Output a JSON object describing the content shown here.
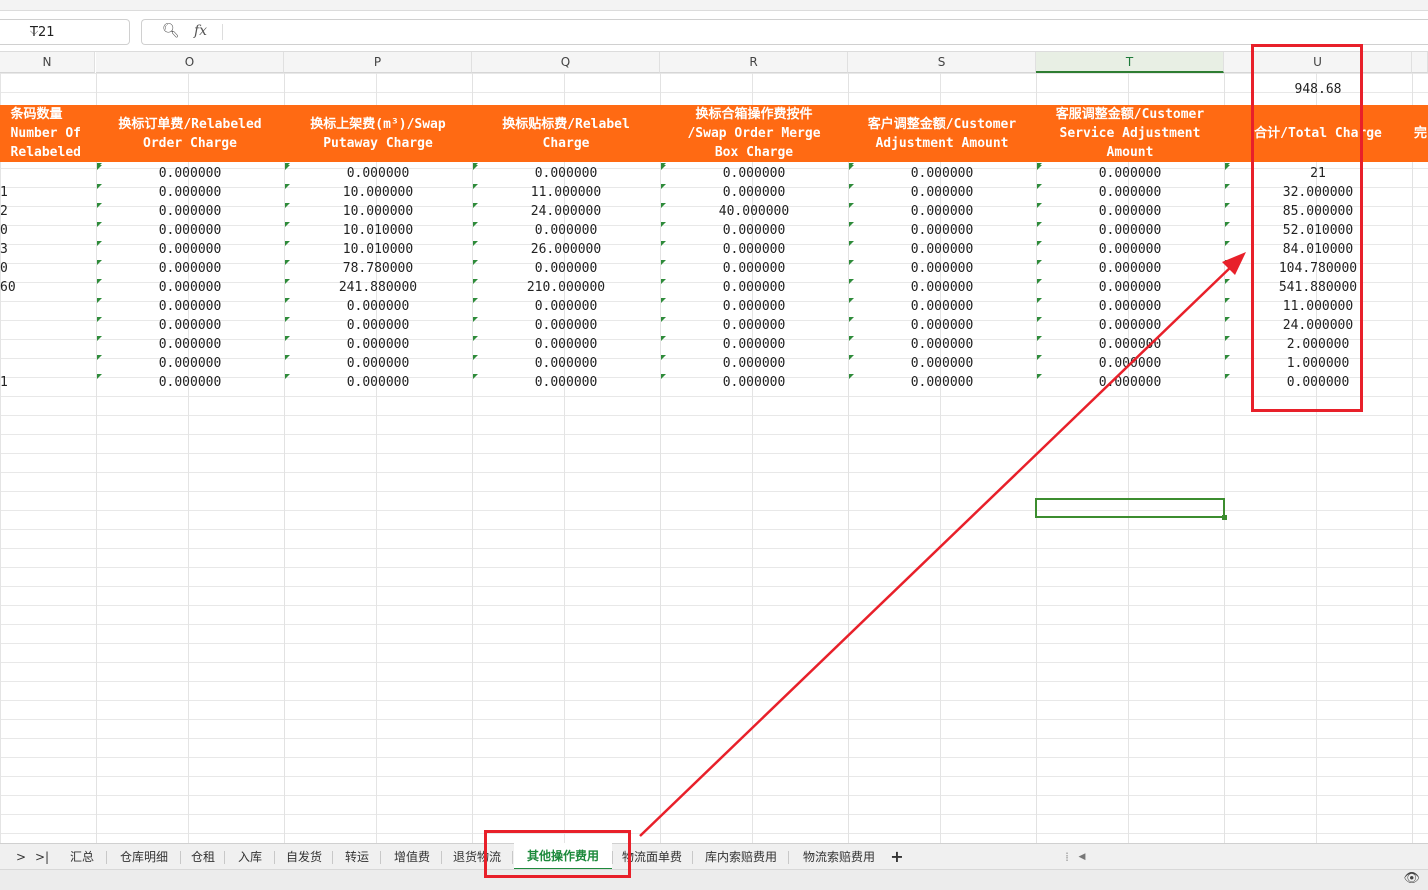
{
  "formula_bar": {
    "cell_ref": "T21",
    "fx_label": "fx",
    "formula": ""
  },
  "columns": [
    "N",
    "O",
    "P",
    "Q",
    "R",
    "S",
    "T",
    "U"
  ],
  "selected_column": "T",
  "summary_total": "948.68",
  "header_row": [
    "条码数量\nNumber Of\nRelabeled",
    "换标订单费/Relabeled\nOrder Charge",
    "换标上架费(m³)/Swap\nPutaway Charge",
    "换标贴标费/Relabel\nCharge",
    "换标合箱操作费按件\n/Swap Order Merge\nBox Charge",
    "客户调整金额/Customer\nAdjustment Amount",
    "客服调整金额/Customer\nService Adjustment\nAmount",
    "合计/Total Charge",
    "完"
  ],
  "rows": [
    [
      "",
      "0.000000",
      "0.000000",
      "0.000000",
      "0.000000",
      "0.000000",
      "0.000000",
      "21"
    ],
    [
      "1",
      "0.000000",
      "10.000000",
      "11.000000",
      "0.000000",
      "0.000000",
      "0.000000",
      "32.000000"
    ],
    [
      "2",
      "0.000000",
      "10.000000",
      "24.000000",
      "40.000000",
      "0.000000",
      "0.000000",
      "85.000000"
    ],
    [
      "0",
      "0.000000",
      "10.010000",
      "0.000000",
      "0.000000",
      "0.000000",
      "0.000000",
      "52.010000"
    ],
    [
      "3",
      "0.000000",
      "10.010000",
      "26.000000",
      "0.000000",
      "0.000000",
      "0.000000",
      "84.010000"
    ],
    [
      "0",
      "0.000000",
      "78.780000",
      "0.000000",
      "0.000000",
      "0.000000",
      "0.000000",
      "104.780000"
    ],
    [
      "60",
      "0.000000",
      "241.880000",
      "210.000000",
      "0.000000",
      "0.000000",
      "0.000000",
      "541.880000"
    ],
    [
      "",
      "0.000000",
      "0.000000",
      "0.000000",
      "0.000000",
      "0.000000",
      "0.000000",
      "11.000000"
    ],
    [
      "",
      "0.000000",
      "0.000000",
      "0.000000",
      "0.000000",
      "0.000000",
      "0.000000",
      "24.000000"
    ],
    [
      "",
      "0.000000",
      "0.000000",
      "0.000000",
      "0.000000",
      "0.000000",
      "0.000000",
      "2.000000"
    ],
    [
      "",
      "0.000000",
      "0.000000",
      "0.000000",
      "0.000000",
      "0.000000",
      "0.000000",
      "1.000000"
    ],
    [
      "1",
      "0.000000",
      "0.000000",
      "0.000000",
      "0.000000",
      "0.000000",
      "0.000000",
      "0.000000"
    ]
  ],
  "sheet_tabs": [
    "汇总",
    "仓库明细",
    "仓租",
    "入库",
    "自发货",
    "转运",
    "增值费",
    "退货物流",
    "其他操作费用",
    "物流面单费",
    "库内索赔费用",
    "物流索赔费用"
  ],
  "active_tab": "其他操作费用",
  "tab_nav": {
    "next": ">",
    "last": ">|",
    "add": "+"
  },
  "colors": {
    "header_orange": "#ff6a13",
    "accent_green": "#1e8a3c",
    "annotation_red": "#e8202a"
  }
}
